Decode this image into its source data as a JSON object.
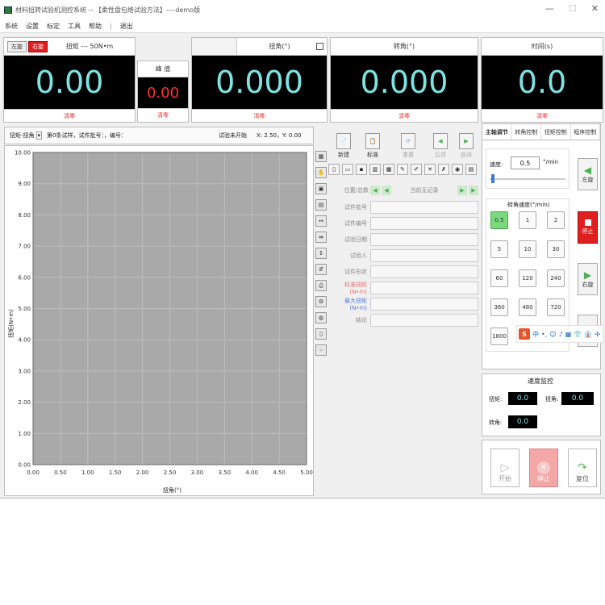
{
  "window": {
    "title": "材料扭转试验机测控系统 -- 【柔性盘包络试验方法】----demo版",
    "minimize": "—",
    "maximize": "☐",
    "close": "✕"
  },
  "menu": [
    "系统",
    "设置",
    "标定",
    "工具",
    "帮助",
    "|",
    "退出"
  ],
  "torque_panel": {
    "dir_left": "左旋",
    "dir_right": "右旋",
    "label": "扭矩 --- 50N•m",
    "value": "0.00",
    "clear": "清零"
  },
  "peak_panel": {
    "label": "峰 值",
    "value": "0.00",
    "clear": "清零"
  },
  "angle_panel": {
    "label": "扭角(°)",
    "value": "0.000",
    "clear": "清零"
  },
  "rotate_panel": {
    "label": "转角(°)",
    "value": "0.000",
    "clear": "清零"
  },
  "time_panel": {
    "label": "时间(s)",
    "value": "0.0",
    "clear": "清零"
  },
  "chart_header": {
    "mode": "扭矩-扭角",
    "dropdown": "▾",
    "info": "第0条试样，试件批号：，编号：",
    "status": "试验未开始",
    "coords": "X: 2.50，Y: 0.00"
  },
  "chart_data": {
    "type": "line",
    "xlabel": "扭角(°)",
    "ylabel": "扭矩(N•m)",
    "xlim": [
      0,
      5
    ],
    "ylim": [
      0,
      10
    ],
    "x_ticks": [
      "0.00",
      "0.50",
      "1.00",
      "1.50",
      "2.00",
      "2.50",
      "3.00",
      "3.50",
      "4.00",
      "4.50",
      "5.00"
    ],
    "y_ticks": [
      "0.00",
      "1.00",
      "2.00",
      "3.00",
      "4.00",
      "5.00",
      "6.00",
      "7.00",
      "8.00",
      "9.00",
      "10.00"
    ],
    "grid": true,
    "series": []
  },
  "toolbar": {
    "new": "新建",
    "standard": "标准",
    "reset": "重置",
    "prev": "后退",
    "next": "前进",
    "nav_label": "位置/总数",
    "nav_status": "当前无记录"
  },
  "form": {
    "batch": "试件批号",
    "number": "试件编号",
    "date": "试验日期",
    "operator": "试验人",
    "shape": "试件形状",
    "calib_torque": "标准扭矩(N•m)",
    "max_torque": "最大扭矩(N•m)",
    "conclusion": "结论"
  },
  "right_tabs": [
    "主轴调节",
    "转角控制",
    "扭矩控制",
    "程序控制"
  ],
  "speed": {
    "label": "速度:",
    "value": "0.5",
    "unit": "°/min",
    "preset_title": "转角速度(°/min)",
    "presets": [
      "0.5",
      "1",
      "2",
      "5",
      "10",
      "30",
      "60",
      "120",
      "240",
      "360",
      "480",
      "720",
      "1800"
    ],
    "left_btn": "左旋",
    "stop_btn": "停止",
    "right_btn": "右旋"
  },
  "monitor": {
    "title": "速度监控",
    "torque_label": "扭矩:",
    "torque_value": "0.0",
    "angle_label": "扭角:",
    "angle_value": "0.0",
    "rotate_label": "转角:",
    "rotate_value": "0.0"
  },
  "actions": {
    "start": "开始",
    "stop": "停止",
    "reset": "复位"
  },
  "ime": [
    "S",
    "中",
    "•,",
    "☺",
    "♪",
    "▦",
    "👕",
    "👔",
    "✣"
  ]
}
